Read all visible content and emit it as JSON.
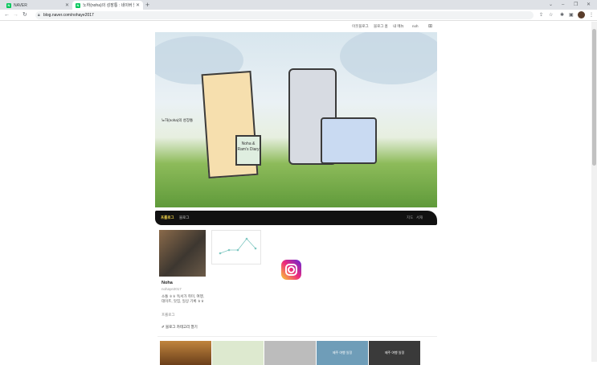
{
  "browser": {
    "tabs": [
      {
        "title": "NAVER",
        "active": false,
        "favicon": "N"
      },
      {
        "title": "노하(noha)의 성장통 : 네이버 블",
        "active": true,
        "favicon": "N"
      }
    ],
    "new_tab": "+",
    "url": "blog.naver.com/nohaye2017",
    "window_controls": [
      "⌄",
      "–",
      "❐",
      "✕"
    ]
  },
  "blog_topnav": {
    "my_blog": "이웃블로그",
    "blog_home": "블로그 홈",
    "my_menu": "내 메뉴",
    "user": "noh"
  },
  "banner": {
    "blog_name": "노하(noha)의 성장통",
    "book_text": "Noha & Ram's Diary"
  },
  "menu": {
    "items": [
      "프롤로그",
      "블로그"
    ],
    "right": [
      "지도",
      "서재"
    ],
    "accent_color": "#f5d64b"
  },
  "profile": {
    "nickname": "Noha",
    "user_id": "nohaye2017",
    "intro": "소통 ㅎㅎ 독서가 취미, 여행, 데이트, 맛집, 일상 기록 ㅎㅎ",
    "prolog_link": "프롤로그"
  },
  "category_button": "✐ 블로그 카테고리 열기",
  "thumbnails": [
    "",
    "",
    "",
    "제주 여행 일정",
    "제주 여행 일정"
  ]
}
